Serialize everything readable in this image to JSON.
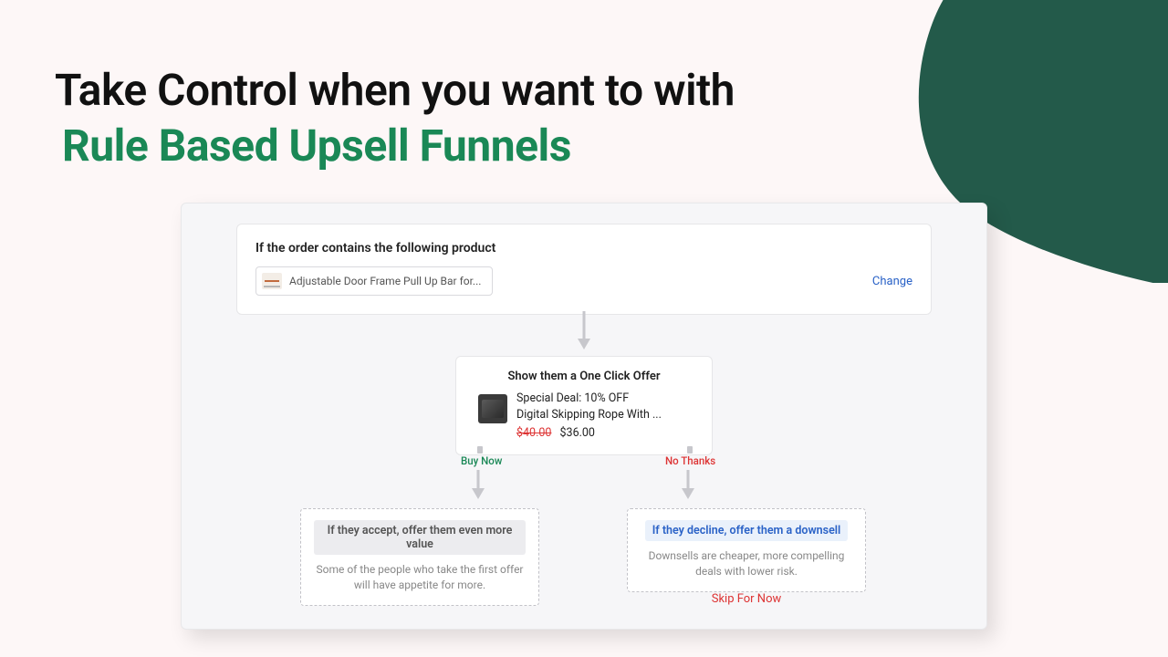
{
  "headline": {
    "line1": "Take Control when you want to with",
    "line2": "Rule Based Upsell Funnels"
  },
  "trigger": {
    "title": "If the order contains the following product",
    "product_name": "Adjustable Door Frame Pull Up Bar for...",
    "change_label": "Change"
  },
  "offer": {
    "title": "Show them a One Click Offer",
    "deal_label": "Special Deal: 10% OFF",
    "product_name": "Digital Skipping Rope With ...",
    "price_old": "$40.00",
    "price_new": "$36.00"
  },
  "branches": {
    "accept_label": "Buy Now",
    "decline_label": "No Thanks"
  },
  "outcomes": {
    "accept": {
      "head": "If they accept, offer them even more value",
      "body": "Some of the people who take the first offer will have appetite for more."
    },
    "decline": {
      "head": "If they decline, offer them a downsell",
      "body": "Downsells are cheaper, more compelling deals with lower risk."
    }
  },
  "skip_label": "Skip For Now",
  "colors": {
    "accent_green": "#1a8856",
    "blob": "#235a4a",
    "link": "#2a62c7",
    "red": "#d33"
  }
}
